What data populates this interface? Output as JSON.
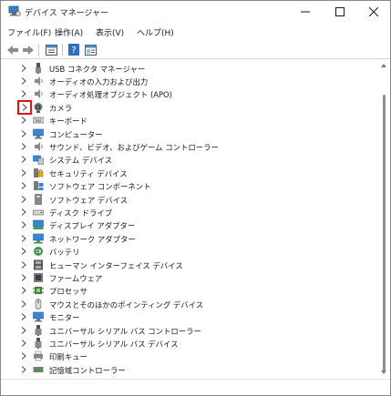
{
  "window": {
    "title": "デバイス マネージャー",
    "minimize_icon": "minimize-icon",
    "maximize_icon": "maximize-icon",
    "close_icon": "close-icon"
  },
  "menu": [
    {
      "label": "ファイル(F)"
    },
    {
      "label": "操作(A)"
    },
    {
      "label": "表示(V)"
    },
    {
      "label": "ヘルプ(H)"
    }
  ],
  "toolbar": [
    "back-arrow-icon",
    "forward-arrow-icon",
    "properties-icon",
    "help-icon",
    "view-panel-icon"
  ],
  "tree": [
    {
      "label": "USB コネクタ マネージャー",
      "icon": "usb-connector-icon"
    },
    {
      "label": "オーディオの入力および出力",
      "icon": "speaker-icon"
    },
    {
      "label": "オーディオ処理オブジェクト (APO)",
      "icon": "speaker-icon"
    },
    {
      "label": "カメラ",
      "icon": "camera-icon",
      "selected": true
    },
    {
      "label": "キーボード",
      "icon": "keyboard-icon"
    },
    {
      "label": "コンピューター",
      "icon": "computer-icon"
    },
    {
      "label": "サウンド、ビデオ、およびゲーム コントローラー",
      "icon": "speaker-icon"
    },
    {
      "label": "システム デバイス",
      "icon": "system-device-icon"
    },
    {
      "label": "セキュリティ デバイス",
      "icon": "security-device-icon"
    },
    {
      "label": "ソフトウェア コンポーネント",
      "icon": "software-component-icon"
    },
    {
      "label": "ソフトウェア デバイス",
      "icon": "software-device-icon"
    },
    {
      "label": "ディスク ドライブ",
      "icon": "disk-drive-icon"
    },
    {
      "label": "ディスプレイ アダプター",
      "icon": "display-adapter-icon"
    },
    {
      "label": "ネットワーク アダプター",
      "icon": "network-adapter-icon"
    },
    {
      "label": "バッテリ",
      "icon": "battery-icon"
    },
    {
      "label": "ヒューマン インターフェイス デバイス",
      "icon": "hid-icon"
    },
    {
      "label": "ファームウェア",
      "icon": "firmware-icon"
    },
    {
      "label": "プロセッサ",
      "icon": "processor-icon"
    },
    {
      "label": "マウスとそのほかのポインティング デバイス",
      "icon": "mouse-icon"
    },
    {
      "label": "モニター",
      "icon": "monitor-icon"
    },
    {
      "label": "ユニバーサル シリアル バス コントローラー",
      "icon": "usb-controller-icon"
    },
    {
      "label": "ユニバーサル シリアル バス デバイス",
      "icon": "usb-controller-icon"
    },
    {
      "label": "印刷キュー",
      "icon": "print-queue-icon"
    },
    {
      "label": "記憶域コントローラー",
      "icon": "storage-controller-icon"
    }
  ],
  "colors": {
    "selection_border": "#e0111b",
    "accent_blue": "#1f78c8"
  }
}
